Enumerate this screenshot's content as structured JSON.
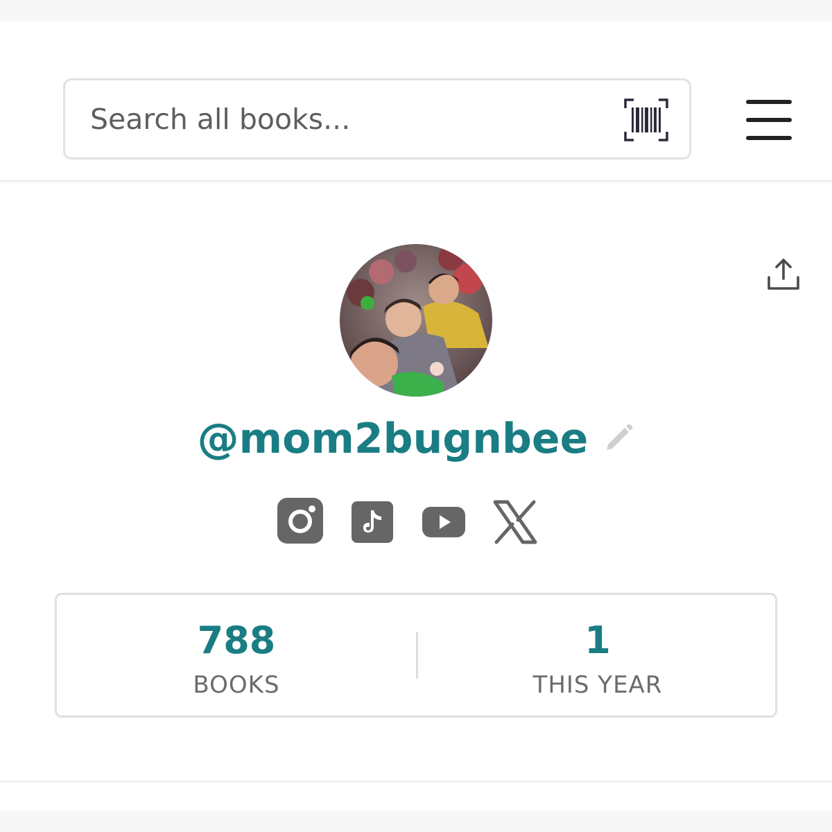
{
  "search": {
    "placeholder": "Search all books...",
    "scan_icon": "barcode-scan-icon"
  },
  "header": {
    "menu_icon": "hamburger-menu-icon"
  },
  "profile": {
    "username": "@mom2bugnbee",
    "share_icon": "share-upload-icon",
    "edit_icon": "pencil-edit-icon",
    "avatar": "profile-photo"
  },
  "socials": [
    {
      "name": "instagram",
      "icon": "instagram-icon"
    },
    {
      "name": "tiktok",
      "icon": "tiktok-icon"
    },
    {
      "name": "youtube",
      "icon": "youtube-icon"
    },
    {
      "name": "x",
      "icon": "x-icon"
    }
  ],
  "stats": {
    "books": {
      "value": "788",
      "label": "BOOKS"
    },
    "this_year": {
      "value": "1",
      "label": "THIS YEAR"
    }
  },
  "colors": {
    "accent": "#1a7d84",
    "icon_gray": "#6a6a6a",
    "border": "#e0e0e0"
  }
}
